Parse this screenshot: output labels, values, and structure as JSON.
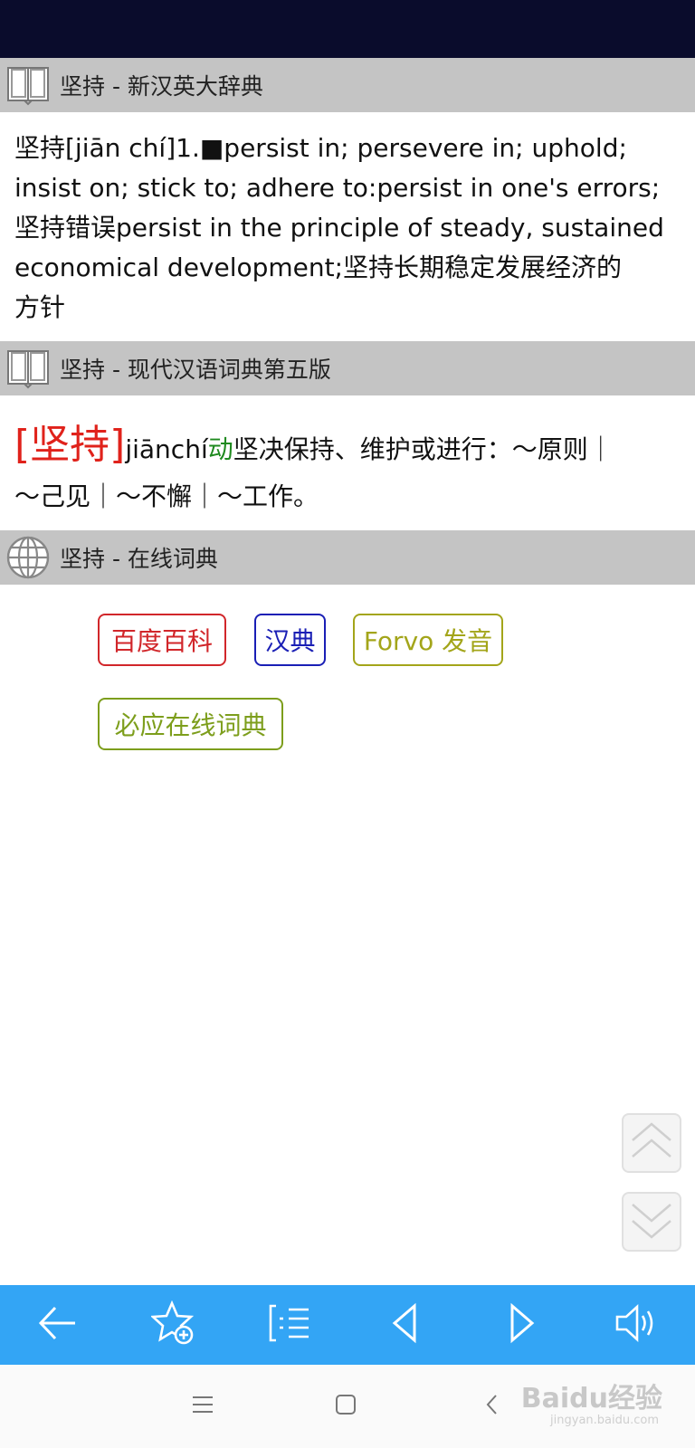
{
  "sections": [
    {
      "title": "坚持 - 新汉英大辞典"
    },
    {
      "title": "坚持 - 现代汉语词典第五版"
    },
    {
      "title": "坚持 - 在线词典"
    }
  ],
  "entry1": {
    "line1": "坚持[jiān chí]1.■persist in; persevere in; uphold;",
    "line2": "insist on; stick to; adhere to:persist in one's errors;",
    "line3": "坚持错误persist in the principle of steady, sustained",
    "line4": "economical development;坚持长期稳定发展经济的",
    "line5": "方针"
  },
  "entry2": {
    "headword": "[坚持]",
    "pinyin": "jiānchí",
    "pos": "动",
    "definition": "坚决保持、维护或进行：～原则｜",
    "examples": "～己见｜～不懈｜～工作。"
  },
  "online_links": {
    "baidu": "百度百科",
    "handian": "汉典",
    "forvo": "Forvo 发音",
    "bing": "必应在线词典"
  },
  "toolbar_icons": [
    "back-arrow-icon",
    "add-favorite-icon",
    "list-icon",
    "prev-icon",
    "next-icon",
    "speaker-icon"
  ],
  "nav_icons": [
    "menu-icon",
    "home-icon",
    "back-icon"
  ],
  "watermark": {
    "text": "Baidu经验",
    "sub": "jingyan.baidu.com"
  },
  "colors": {
    "status_bar": "#0a0c2c",
    "header_bg": "#c4c4c4",
    "toolbar": "#33a5f5",
    "headword": "#e0221b",
    "pos": "#1f8a1f"
  }
}
